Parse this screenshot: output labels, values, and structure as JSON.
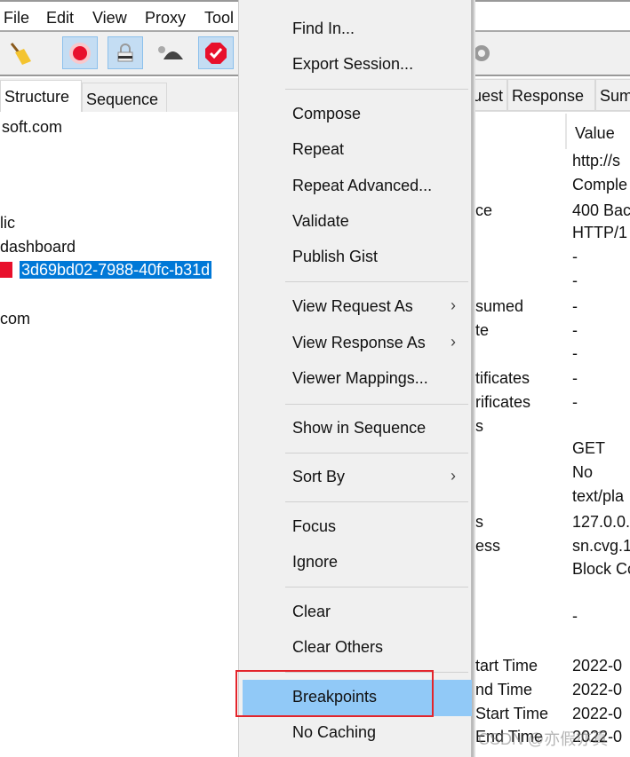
{
  "menubar": {
    "items": [
      "File",
      "Edit",
      "View",
      "Proxy",
      "Tool"
    ]
  },
  "toolbar": {
    "icons": [
      "broom-icon",
      "record-icon",
      "ssl-lock-icon",
      "throttle-turtle-icon",
      "breakpoint-stop-icon",
      "gear-icon"
    ]
  },
  "left_tabs": [
    "Structure",
    "Sequence"
  ],
  "tree": {
    "items": [
      "soft.com",
      "lic",
      "dashboard",
      "3d69bd02-7988-40fc-b31d",
      "com"
    ],
    "selected": "3d69bd02-7988-40fc-b31d"
  },
  "right_tabs": [
    "uest",
    "Response",
    "Sum"
  ],
  "properties": {
    "value_header": "Value",
    "rows": [
      {
        "name": "",
        "value": "http://s"
      },
      {
        "name": "",
        "value": "Comple"
      },
      {
        "name": "ce",
        "value": "400 Bac"
      },
      {
        "name": "",
        "value": "HTTP/1"
      },
      {
        "name": "",
        "value": "-"
      },
      {
        "name": "",
        "value": "-"
      },
      {
        "name": "sumed",
        "value": "-"
      },
      {
        "name": "te",
        "value": "-"
      },
      {
        "name": "",
        "value": "-"
      },
      {
        "name": "tificates",
        "value": "-"
      },
      {
        "name": "rificates",
        "value": "-"
      },
      {
        "name": "s",
        "value": ""
      },
      {
        "name": "",
        "value": "GET"
      },
      {
        "name": "",
        "value": "No"
      },
      {
        "name": "",
        "value": "text/pla"
      },
      {
        "name": "s",
        "value": "127.0.0."
      },
      {
        "name": "ess",
        "value": "sn.cvg.1"
      },
      {
        "name": "",
        "value": "Block Co"
      },
      {
        "name": "",
        "value": "-"
      },
      {
        "name": "tart Time",
        "value": "2022-0"
      },
      {
        "name": "nd Time",
        "value": "2022-0"
      },
      {
        "name": "Start Time",
        "value": "2022-0"
      },
      {
        "name": "End Time",
        "value": "2022-0"
      }
    ]
  },
  "context_menu": {
    "items": [
      {
        "label": "Find In..."
      },
      {
        "label": "Export Session..."
      },
      {
        "label": "Compose"
      },
      {
        "label": "Repeat"
      },
      {
        "label": "Repeat Advanced..."
      },
      {
        "label": "Validate"
      },
      {
        "label": "Publish Gist"
      },
      {
        "label": "View Request As",
        "submenu": true
      },
      {
        "label": "View Response As",
        "submenu": true
      },
      {
        "label": "Viewer Mappings..."
      },
      {
        "label": "Show in Sequence"
      },
      {
        "label": "Sort By",
        "submenu": true
      },
      {
        "label": "Focus"
      },
      {
        "label": "Ignore"
      },
      {
        "label": "Clear"
      },
      {
        "label": "Clear Others"
      },
      {
        "label": "Breakpoints",
        "highlighted": true
      },
      {
        "label": "No Caching"
      }
    ],
    "submenu_arrow": "›"
  },
  "watermark": "CSDN @亦假亦真",
  "colors": {
    "selection": "#0078d7",
    "menu_highlight": "#91c9f7",
    "annotation_box": "#e3242b"
  }
}
